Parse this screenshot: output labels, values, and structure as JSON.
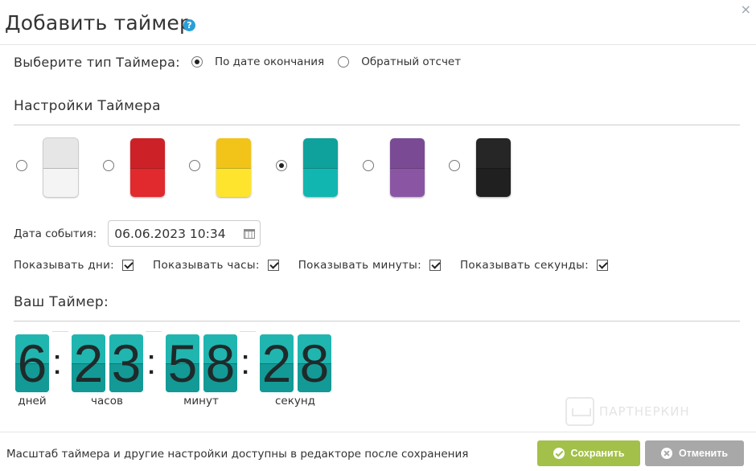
{
  "dialog": {
    "title": "Добавить таймер",
    "help_icon": "question-circle-icon",
    "help_glyph": "?",
    "close_glyph": "×"
  },
  "timer_type": {
    "label": "Выберите тип Таймера:",
    "options": [
      {
        "label": "По дате окончания",
        "checked": true
      },
      {
        "label": "Обратный отсчет",
        "checked": false
      }
    ]
  },
  "settings": {
    "heading": "Настройки Таймера",
    "color_themes": [
      {
        "name": "white",
        "top": "#e6e6e6",
        "bottom": "#f4f4f4",
        "selected": false
      },
      {
        "name": "red",
        "top": "#cc2227",
        "bottom": "#e02a2e",
        "selected": false
      },
      {
        "name": "yellow",
        "top": "#f2c318",
        "bottom": "#fee42c",
        "selected": false
      },
      {
        "name": "teal",
        "top": "#0fa29d",
        "bottom": "#12b6b0",
        "selected": true
      },
      {
        "name": "purple",
        "top": "#7a4b94",
        "bottom": "#8a56a4",
        "selected": false
      },
      {
        "name": "black",
        "top": "#262626",
        "bottom": "#202020",
        "selected": false
      }
    ],
    "event_date_label": "Дата события:",
    "event_date_value": "06.06.2023 10:34",
    "show_options": [
      {
        "label": "Показывать дни:",
        "checked": true
      },
      {
        "label": "Показывать часы:",
        "checked": true
      },
      {
        "label": "Показывать минуты:",
        "checked": true
      },
      {
        "label": "Показывать секунды:",
        "checked": true
      }
    ]
  },
  "preview": {
    "heading": "Ваш Таймер:",
    "days": "6",
    "hours": [
      "2",
      "3"
    ],
    "minutes": [
      "5",
      "8"
    ],
    "seconds": [
      "2",
      "8"
    ],
    "separator": ":",
    "units": {
      "days": "дней",
      "hours": "часов",
      "minutes": "минут",
      "seconds": "секунд"
    }
  },
  "watermark": {
    "text": "ПАРТНЕРКИН"
  },
  "footer": {
    "note": "Масштаб таймера и другие настройки доступны в редакторе после сохранения",
    "save_label": "Сохранить",
    "cancel_label": "Отменить"
  }
}
